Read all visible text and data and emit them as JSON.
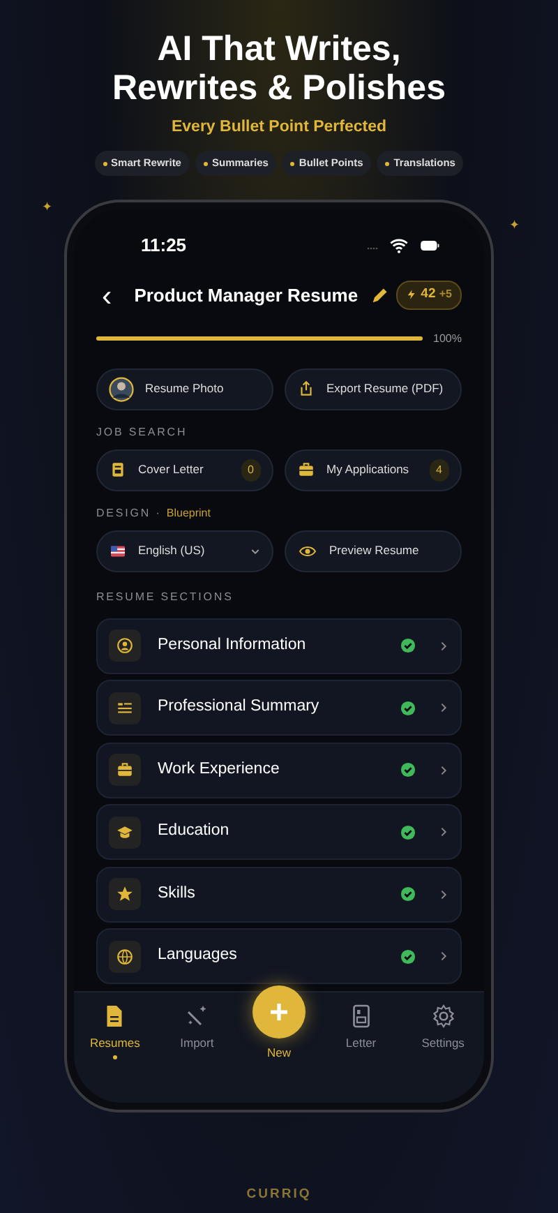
{
  "promo": {
    "title": "AI That Writes, Rewrites & Polishes",
    "subtitle": "Every Bullet Point Perfected",
    "features": [
      "Smart Rewrite",
      "Summaries",
      "Bullet Points",
      "Translations"
    ],
    "brand": "CURRIQ",
    "sparkles": [
      "✦",
      "✦"
    ]
  },
  "status_bar": {
    "time": "11:25"
  },
  "header": {
    "back": "‹",
    "title": "Product Manager Resume",
    "credits": "42",
    "bonus": "+5"
  },
  "progress": {
    "level": 1.0,
    "reading": "100%"
  },
  "quick_actions": [
    {
      "kind": "photo",
      "label": "Resume Photo"
    },
    {
      "kind": "export",
      "label": "Export Resume (PDF)"
    }
  ],
  "job_search": {
    "heading": "JOB SEARCH",
    "items": [
      {
        "kind": "letter",
        "label": "Cover Letter",
        "count": "0"
      },
      {
        "kind": "case",
        "label": "My Applications",
        "count": "4"
      }
    ]
  },
  "design": {
    "heading": "DESIGN",
    "separator": "·",
    "template": "Blueprint",
    "language": "English (US)",
    "preview": "Preview Resume"
  },
  "sections": {
    "heading": "RESUME SECTIONS",
    "items": [
      {
        "kind": "person",
        "label": "Personal Information",
        "complete": true
      },
      {
        "kind": "summary",
        "label": "Professional Summary",
        "complete": true
      },
      {
        "kind": "case",
        "label": "Work Experience",
        "complete": true
      },
      {
        "kind": "cap",
        "label": "Education",
        "complete": true
      },
      {
        "kind": "star",
        "label": "Skills",
        "complete": true
      },
      {
        "kind": "globe",
        "label": "Languages",
        "complete": true
      }
    ]
  },
  "tab_bar": [
    {
      "kind": "doc",
      "label": "Resumes",
      "selected": true
    },
    {
      "kind": "wand",
      "label": "Import",
      "selected": false
    },
    {
      "kind": "plus",
      "label": "New",
      "selected": false
    },
    {
      "kind": "letter",
      "label": "Letter",
      "selected": false
    },
    {
      "kind": "gear",
      "label": "Settings",
      "selected": false
    }
  ]
}
